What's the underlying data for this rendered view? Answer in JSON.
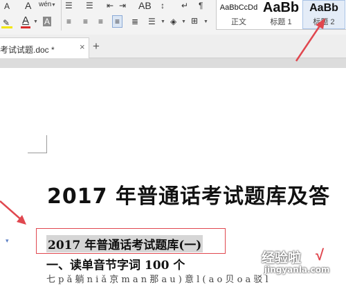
{
  "ribbon": {
    "font_size_a_label": "A",
    "font_size_a_small_label": "A",
    "phonetic_label": "wén",
    "font_color_label": "A",
    "char_shade_label": "A",
    "text_effect_label": "AB",
    "styles": [
      {
        "sample": "AaBbCcDd",
        "caption": "正文"
      },
      {
        "sample": "AaBb",
        "caption": "标题 1"
      },
      {
        "sample": "AaBb",
        "caption": "标题 2"
      }
    ],
    "colors": {
      "font_color_bar": "#d82b2b",
      "highlight_bar": "#f2e600"
    }
  },
  "tabs": {
    "document_tab_label": "考试试题.doc *",
    "close_glyph": "×",
    "new_tab_glyph": "+"
  },
  "document": {
    "title": "2017 年普通话考试题库及答",
    "selected_heading": "2017 年普通话考试题库(一)",
    "section_heading": "一、读单音节字词 100 个",
    "partial_line": "七 p ǎ 躺 n i ǎ 京 m a n 那 a u ) 意 l ( a o 贝 o a 驳 l"
  },
  "watermark": {
    "top": "经验啦",
    "check": "√",
    "bottom": "jingyanla.com"
  },
  "annotation_colors": {
    "arrow": "#e0474f"
  }
}
